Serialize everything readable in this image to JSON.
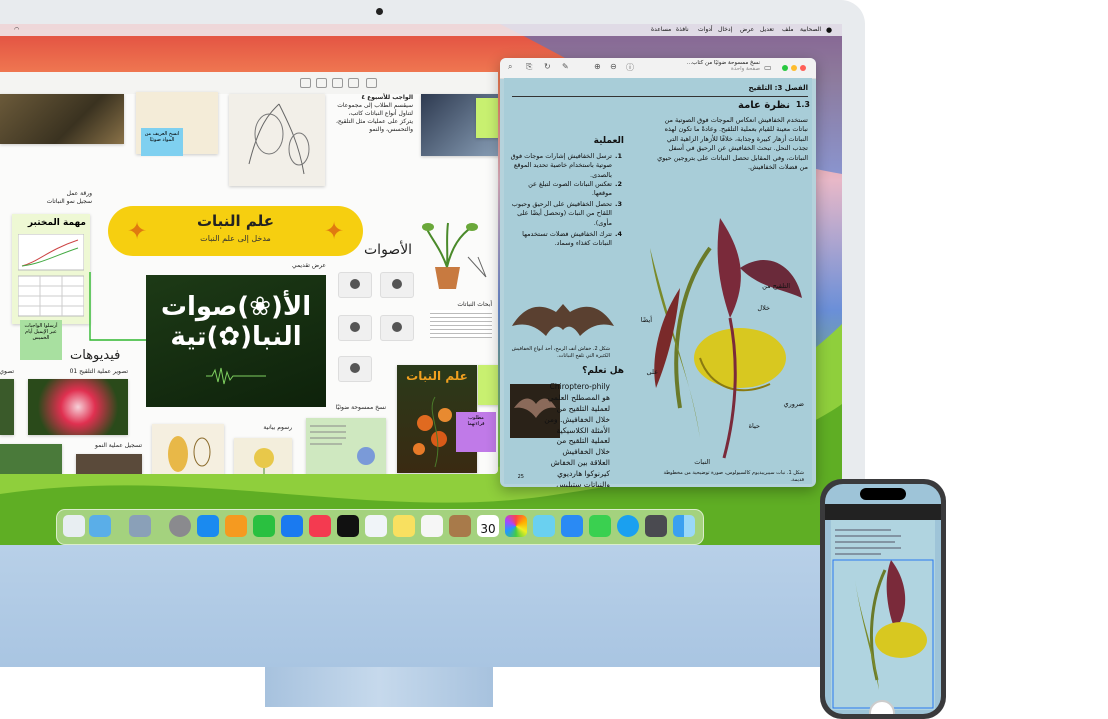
{
  "menubar": {
    "items": [
      "الصحابية",
      "ملف",
      "تعديل",
      "عرض",
      "إدخال",
      "أدوات",
      "نافذة",
      "مساعدة"
    ]
  },
  "freeform": {
    "sticky_blue": "انسخ العريف من المواد صوتيًا",
    "sticky_green": "أرسلوا الواجبات عبر الإيميل أيام الخميس",
    "sticky_purple": "مطلوب قراءتهما",
    "homework_title": "الواجب للأسبوع ٤",
    "homework_text": "سيقسم الطلاب إلى مجموعات لتناول أنواع النباتات كاتب، يتركز على عمليات مثل التلقيح، والتحسس، والنمو",
    "worksheet_label": "ورقة عمل",
    "worksheet_sub": "سجيل نمو النباتات",
    "lab_title": "مهمة المختبر",
    "banner_title": "علم النبات",
    "banner_sub": "مدخل إلى علم النبات",
    "present_label": "عرض تقديمي",
    "present_title_line1": "الأ(❀)صوات",
    "present_title_line2": "النبا(✿)تية",
    "sounds_title": "الأصوات",
    "plant_research": "أبحاث النباتات",
    "videos_title": "فيديوهات",
    "video1": "تصوير عملية التلقيح 01",
    "video2": "تسجيل عملية النمو",
    "drawings": "رسوم بيانية",
    "scanned": "نسخ ممسوحة ضوئيًا",
    "book_title": "علم النبات",
    "partial_label": "تصوي"
  },
  "preview": {
    "window_title": "نسخ ممسوحة ضوئيًا من كتاب...",
    "window_subtitle": "صفحة واحدة",
    "chapter": "الفصل 3: التلقيح",
    "section_num": "1.3",
    "section_title": "نظرة عامة",
    "overview_text": "تستخدم الخفافيش انعكاس الموجات فوق الصوتية من نباتات معينة للقيام بعملية التلقيح. وعادةً ما تكون لهذه النباتات أزهار كبيرة وجذابة، خلافًا للأزهار الزاهية التي تجذب النحل. تبحث الخفافيش عن الرحيق في أسفل النباتات، وفي المقابل تحصل النباتات على بتروجين حيوي من فضلات الخفافيش.",
    "process_title": "العملية",
    "steps": [
      "ترسل الخفافيش إشارات موجات فوق صوتية باستخدام خاصية تحديد الموقع بالصدى.",
      "تعكس النباتات الصوت لتبلغ عن موقعها.",
      "تحصل الخفافيش على الرحيق وحبوب اللقاح من النبات (وتحصل أيضًا على مأوى).",
      "تترك الخفافيش فضلات تستخدمها النباتات كغذاء وسماد."
    ],
    "step_nums": [
      "1.",
      "2.",
      "3.",
      "4."
    ],
    "figure_bat": "شكل 2. خفاش أنف الرمح، أحد أنواع الخفافيش الكثيرة التي تلقح النباتات.",
    "did_you_know": "هل تعلم؟",
    "dyk_text": "Chiroptero-phily هو المصطلح العلمي لعملية التلقيح من خلال الخفافيش. ومن الأمثلة الكلاسيكية لعملية التلقيح من خلال الخفافيش العلاقة بين الخفاش كيرنوكوا هارديوي والنباتات ستيليس هيسبيلان",
    "flower_labels": [
      "التلقيح من",
      "النبات",
      "ضروري",
      "خلال",
      "حياة",
      "أيضًا",
      "على"
    ],
    "figure_caption": "شكل 1. نبات سيبريبديوم كالسيولوس، صورة توضيحية من مخطوطة قديمة.",
    "page_num": "25"
  },
  "dock": {
    "calendar_day": "30"
  },
  "colors": {
    "banner": "#f6cf10",
    "sticky_blue": "#7fd0f0",
    "sticky_green": "#a8e0a0",
    "sticky_purple": "#c07ae8",
    "preview_page": "#a8cdd8"
  }
}
